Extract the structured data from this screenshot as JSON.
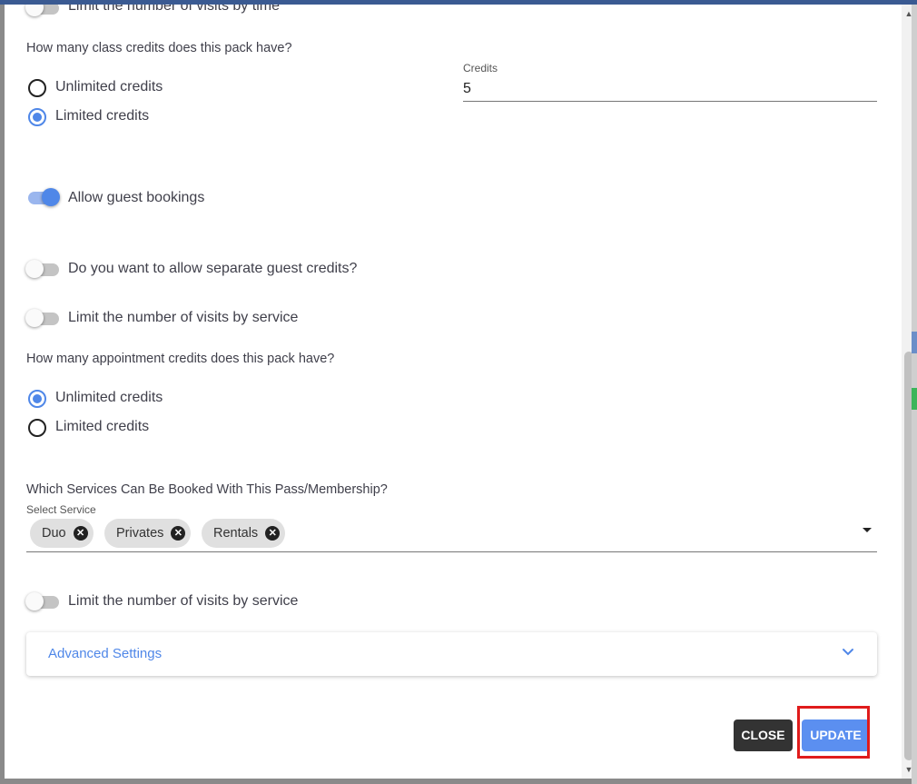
{
  "form": {
    "visits_by_time_toggle": {
      "label": "Limit the number of visits by time",
      "on": false
    },
    "class_credits": {
      "question": "How many class credits does this pack have?",
      "options": [
        "Unlimited credits",
        "Limited credits"
      ],
      "selected": "Limited credits",
      "credits_label": "Credits",
      "credits_value": "5"
    },
    "allow_guest_toggle": {
      "label": "Allow guest bookings",
      "on": true
    },
    "separate_guest_credits_toggle": {
      "label": "Do you want to allow separate guest credits?",
      "on": false
    },
    "visits_by_service_toggle_1": {
      "label": "Limit the number of visits by service",
      "on": false
    },
    "appointment_credits": {
      "question": "How many appointment credits does this pack have?",
      "options": [
        "Unlimited credits",
        "Limited credits"
      ],
      "selected": "Unlimited credits"
    },
    "services": {
      "question": "Which Services Can Be Booked With This Pass/Membership?",
      "select_label": "Select Service",
      "chips": [
        "Duo",
        "Privates",
        "Rentals"
      ]
    },
    "visits_by_service_toggle_2": {
      "label": "Limit the number of visits by service",
      "on": false
    },
    "advanced_settings": {
      "title": "Advanced Settings"
    }
  },
  "actions": {
    "close_label": "CLOSE",
    "update_label": "UPDATE"
  },
  "colors": {
    "accent": "#4f87e8",
    "close_button": "#333333",
    "update_button": "#5b8ff0",
    "highlight_border": "#e01b1b"
  }
}
